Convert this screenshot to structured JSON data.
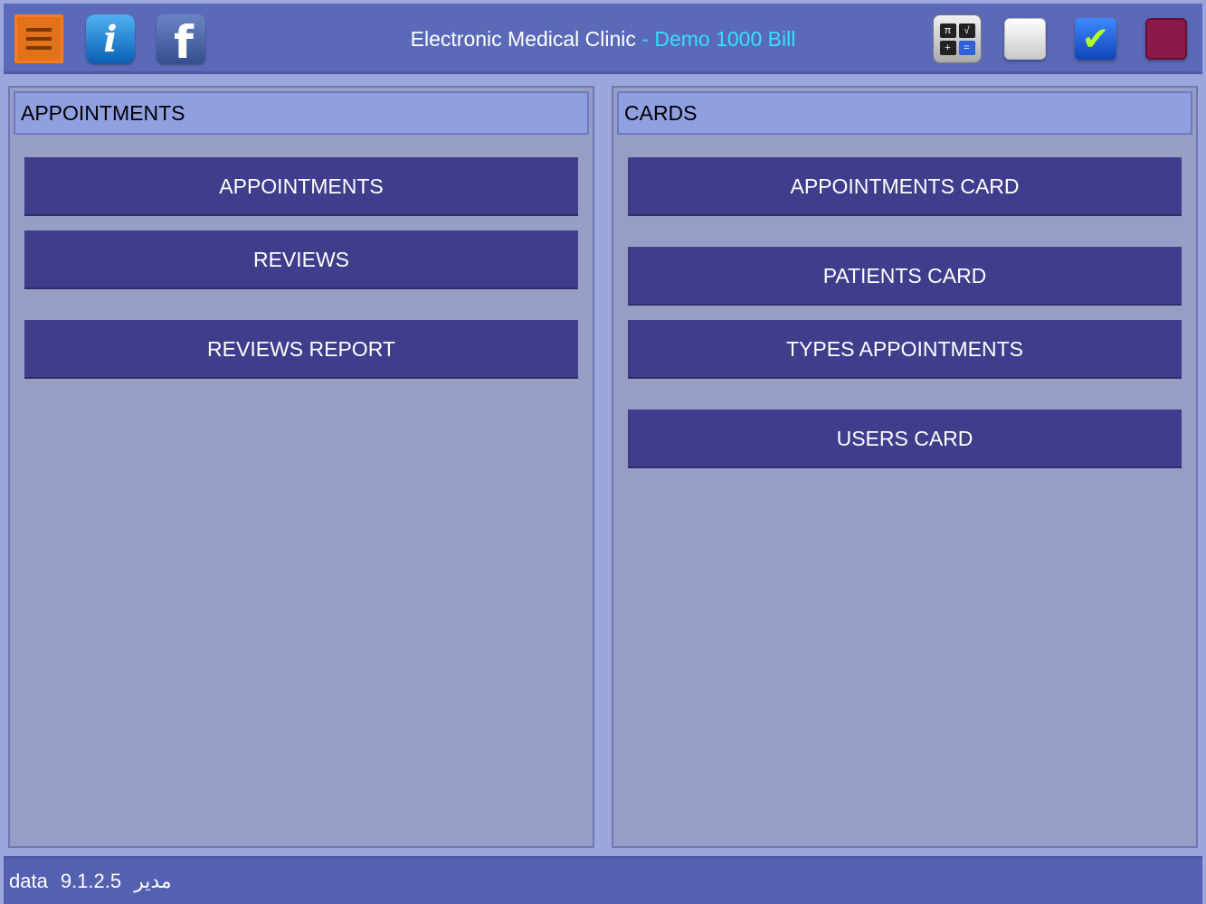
{
  "header": {
    "title_main": "Electronic Medical Clinic",
    "title_sep": " - ",
    "title_demo": "Demo 1000 Bill",
    "info_glyph": "i",
    "fb_glyph": "f",
    "check_glyph": "✔",
    "calc_keys": [
      "π",
      "√",
      "+",
      "="
    ],
    "icons": {
      "menu": "menu-icon",
      "info": "info-icon",
      "facebook": "facebook-icon",
      "calculator": "calculator-icon",
      "white": "blank-square-icon",
      "check": "checkmark-icon",
      "red": "red-square-icon"
    }
  },
  "left_panel": {
    "header": "APPOINTMENTS",
    "buttons": [
      "APPOINTMENTS",
      "REVIEWS",
      "REVIEWS REPORT"
    ]
  },
  "right_panel": {
    "header": "CARDS",
    "buttons": [
      "APPOINTMENTS CARD",
      "PATIENTS CARD",
      "TYPES APPOINTMENTS",
      "USERS CARD"
    ]
  },
  "footer": {
    "db": "data",
    "version": "9.1.2.5",
    "role": "مدير"
  },
  "colors": {
    "background": "#9aa6dc",
    "topbar": "#5a69b8",
    "panel": "#979ec4",
    "panel_header": "#8f9fe0",
    "button": "#3f3d8c",
    "demo_text": "#35e0ff",
    "menu_orange": "#e2711a"
  }
}
